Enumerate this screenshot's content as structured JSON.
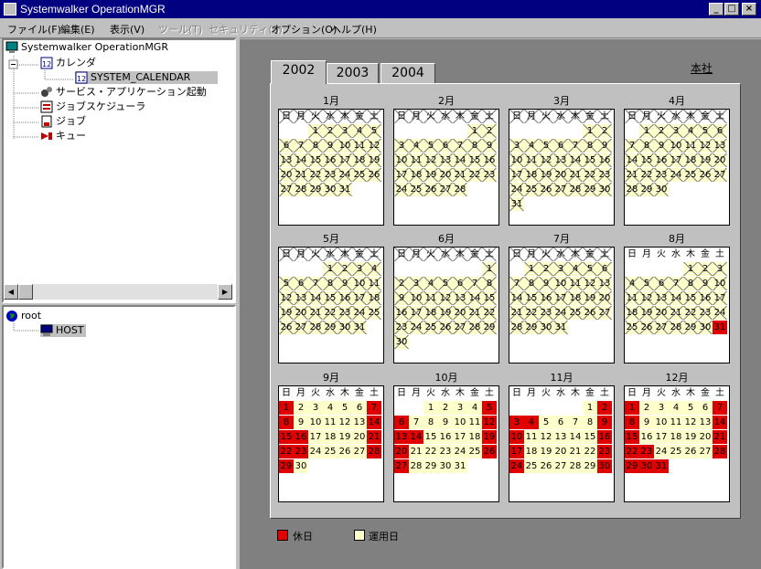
{
  "window": {
    "title": "Systemwalker OperationMGR"
  },
  "menu": [
    {
      "label": "ファイル(F)",
      "enabled": true
    },
    {
      "label": "編集(E)",
      "enabled": true
    },
    {
      "label": "表示(V)",
      "enabled": true
    },
    {
      "label": "ツール(T)",
      "enabled": false
    },
    {
      "label": "セキュリティ(S)",
      "enabled": false
    },
    {
      "label": "オプション(O)",
      "enabled": true
    },
    {
      "label": "ヘルプ(H)",
      "enabled": true
    }
  ],
  "tree": {
    "root_label": "Systemwalker OperationMGR",
    "calendar_label": "カレンダ",
    "system_calendar_label": "SYSTEM_CALENDAR",
    "service_label": "サービス・アプリケーション起動",
    "scheduler_label": "ジョブスケジューラ",
    "job_label": "ジョブ",
    "queue_label": "キュー"
  },
  "hosts": {
    "root_label": "root",
    "host_label": "HOST"
  },
  "tabs": [
    {
      "label": "2002",
      "active": true
    },
    {
      "label": "2003",
      "active": false
    },
    {
      "label": "2004",
      "active": false
    }
  ],
  "office": "本社",
  "weekdays": [
    "日",
    "月",
    "火",
    "水",
    "木",
    "金",
    "土"
  ],
  "colors": {
    "holiday": "#e00000",
    "operating": "#ffffcc"
  },
  "legend": {
    "holiday": "休日",
    "operating": "運用日"
  },
  "months": [
    {
      "label": "1月",
      "start": 2,
      "days": 31,
      "holidays": [],
      "style": "x"
    },
    {
      "label": "2月",
      "start": 5,
      "days": 28,
      "holidays": [],
      "style": "x"
    },
    {
      "label": "3月",
      "start": 5,
      "days": 31,
      "holidays": [],
      "style": "x"
    },
    {
      "label": "4月",
      "start": 1,
      "days": 30,
      "holidays": [],
      "style": "x"
    },
    {
      "label": "5月",
      "start": 3,
      "days": 31,
      "holidays": [],
      "style": "x"
    },
    {
      "label": "6月",
      "start": 6,
      "days": 30,
      "holidays": [],
      "style": "x"
    },
    {
      "label": "7月",
      "start": 1,
      "days": 31,
      "holidays": [],
      "style": "x"
    },
    {
      "label": "8月",
      "start": 4,
      "days": 31,
      "holidays": [
        31
      ],
      "style": "x",
      "plain_header": true
    },
    {
      "label": "9月",
      "start": 0,
      "days": 30,
      "holidays": [
        1,
        7,
        8,
        14,
        15,
        16,
        21,
        22,
        23,
        28,
        29
      ],
      "style": "o"
    },
    {
      "label": "10月",
      "start": 2,
      "days": 31,
      "holidays": [
        5,
        6,
        12,
        13,
        14,
        19,
        20,
        26,
        27
      ],
      "style": "o"
    },
    {
      "label": "11月",
      "start": 5,
      "days": 30,
      "holidays": [
        2,
        3,
        4,
        9,
        10,
        16,
        17,
        23,
        24,
        30
      ],
      "style": "o"
    },
    {
      "label": "12月",
      "start": 0,
      "days": 31,
      "holidays": [
        1,
        7,
        8,
        14,
        15,
        21,
        22,
        23,
        28,
        29,
        30,
        31
      ],
      "style": "o"
    }
  ]
}
